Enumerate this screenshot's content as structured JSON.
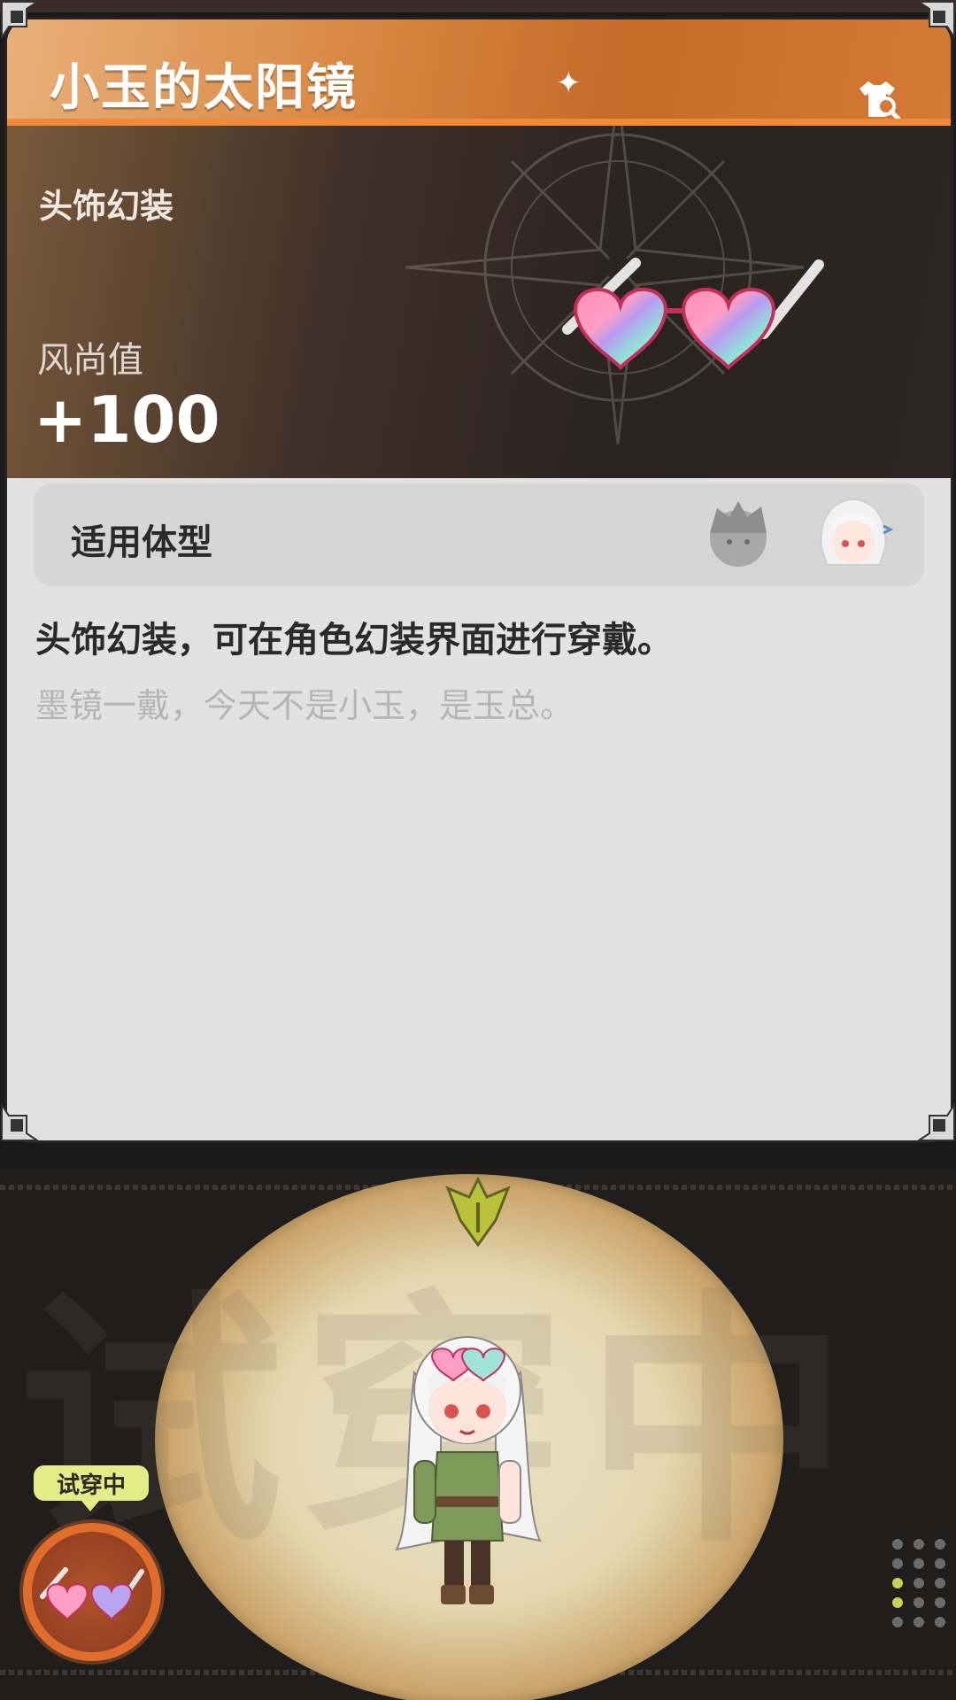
{
  "title": "小玉的太阳镜",
  "category": "头饰幻装",
  "fashion": {
    "label": "风尚值",
    "value": "+100"
  },
  "body_type": {
    "label": "适用体型"
  },
  "description": "头饰幻装，可在角色幻装界面进行穿戴。",
  "flavor_text": "墨镜一戴，今天不是小玉，是玉总。",
  "preview": {
    "watermark": "试穿中",
    "tag": "试穿中"
  },
  "colors": {
    "accent": "#e06d2b",
    "tag": "#e4ec8a"
  },
  "icons": [
    "wardrobe-search-icon",
    "male-body-avatar",
    "female-body-avatar",
    "arrow-down-icon"
  ]
}
